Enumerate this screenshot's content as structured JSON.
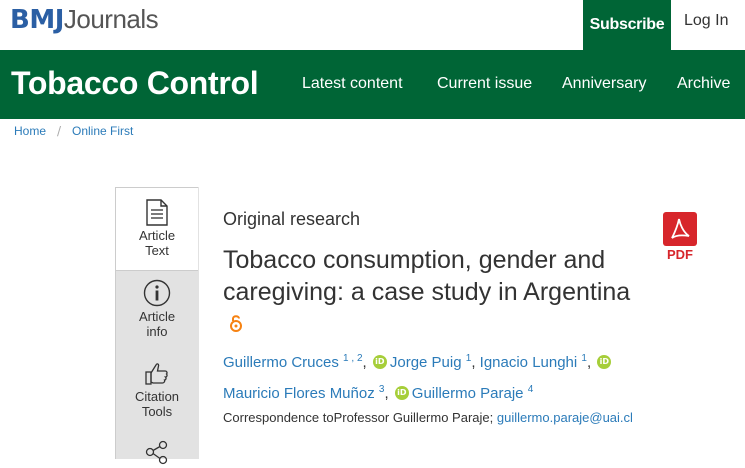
{
  "header": {
    "logo_bmj": "BMJ",
    "logo_journals": "Journals",
    "subscribe_label": "Subscribe",
    "login_label": "Log In"
  },
  "nav": {
    "brand": "Tobacco Control",
    "links": [
      "Latest content",
      "Current issue",
      "Anniversary",
      "Archive"
    ]
  },
  "breadcrumb": [
    "Home",
    "Online First"
  ],
  "tools": [
    {
      "label1": "Article",
      "label2": "Text",
      "icon": "document-icon"
    },
    {
      "label1": "Article",
      "label2": "info",
      "icon": "info-icon"
    },
    {
      "label1": "Citation",
      "label2": "Tools",
      "icon": "thumbs-up-icon"
    },
    {
      "label1": "",
      "label2": "",
      "icon": "share-icon"
    }
  ],
  "article": {
    "type": "Original research",
    "title": "Tobacco consumption, gender and caregiving: a case study in Argentina",
    "pdf_label": "PDF",
    "authors": [
      {
        "name": "Guillermo Cruces",
        "sup": "1 , 2"
      },
      {
        "name": "Jorge Puig",
        "sup": "1"
      },
      {
        "name": "Ignacio Lunghi",
        "sup": "1"
      },
      {
        "name": "Mauricio Flores Muñoz",
        "sup": "3"
      },
      {
        "name": "Guillermo Paraje",
        "sup": "4"
      }
    ],
    "correspondence_prefix": "Correspondence toProfessor Guillermo Paraje;",
    "correspondence_email": "guillermo.paraje@uai.cl"
  },
  "colors": {
    "brand_green": "#006536",
    "link_blue": "#2b7bb9",
    "orcid_green": "#a6ce39",
    "pdf_red": "#d7262b",
    "oa_orange": "#f68212"
  }
}
